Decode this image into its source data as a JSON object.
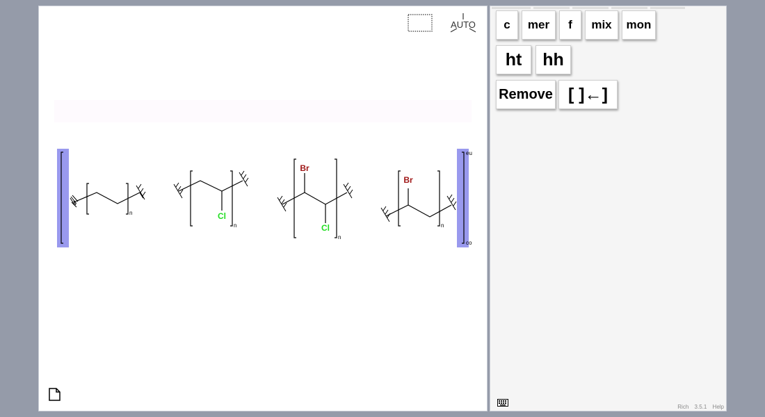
{
  "toolbar": {
    "row1": [
      {
        "id": "c",
        "label": "c"
      },
      {
        "id": "mer",
        "label": "mer"
      },
      {
        "id": "f",
        "label": "f"
      },
      {
        "id": "mix",
        "label": "mix"
      },
      {
        "id": "mon",
        "label": "mon"
      }
    ],
    "row2": [
      {
        "id": "ht",
        "label": "ht"
      },
      {
        "id": "hh",
        "label": "hh"
      }
    ],
    "row3": [
      {
        "id": "remove",
        "label": "Remove"
      },
      {
        "id": "bracket",
        "label": "[ ]←]"
      }
    ]
  },
  "canvas": {
    "auto_label": "AUTO",
    "outer_bracket": {
      "top_label": "eu",
      "bottom_label": "co"
    },
    "repeat_label": "n",
    "atoms": {
      "cl": "Cl",
      "br": "Br"
    },
    "colors": {
      "cl": "#22dd22",
      "br": "#a01818",
      "highlight": "#9999ee"
    }
  },
  "footer": {
    "name": "Rich",
    "version": "3.5.1",
    "help": "Help"
  }
}
